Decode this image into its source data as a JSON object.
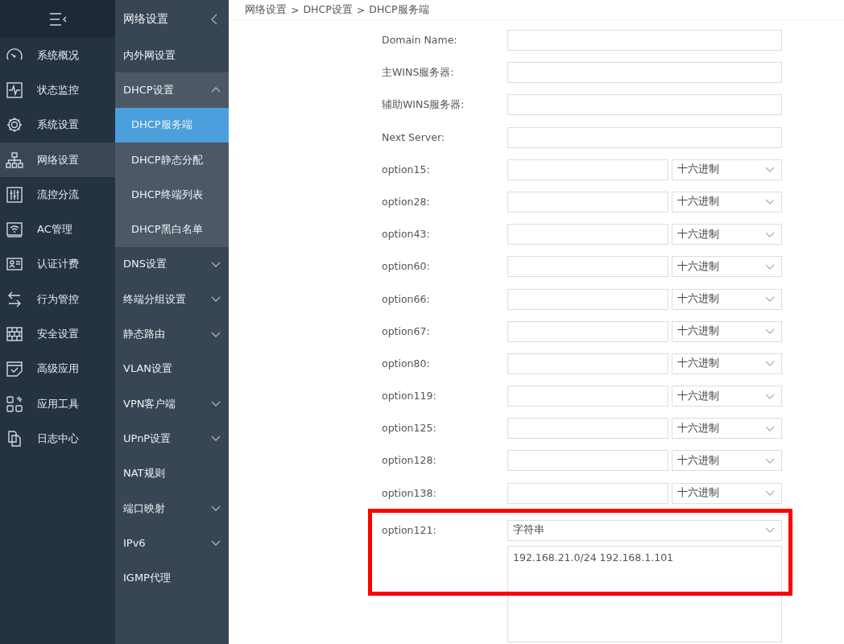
{
  "main_nav": {
    "items": [
      {
        "label": "系统概况",
        "selected": false
      },
      {
        "label": "状态监控",
        "selected": false
      },
      {
        "label": "系统设置",
        "selected": false
      },
      {
        "label": "网络设置",
        "selected": true
      },
      {
        "label": "流控分流",
        "selected": false
      },
      {
        "label": "AC管理",
        "selected": false
      },
      {
        "label": "认证计费",
        "selected": false
      },
      {
        "label": "行为管控",
        "selected": false
      },
      {
        "label": "安全设置",
        "selected": false
      },
      {
        "label": "高级应用",
        "selected": false
      },
      {
        "label": "应用工具",
        "selected": false
      },
      {
        "label": "日志中心",
        "selected": false
      }
    ]
  },
  "sub_nav": {
    "title": "网络设置",
    "items": [
      {
        "label": "内外网设置",
        "selected": false
      },
      {
        "label": "DHCP设置",
        "selected": false,
        "expanded": true,
        "children": [
          {
            "label": "DHCP服务端",
            "selected": true
          },
          {
            "label": "DHCP静态分配",
            "selected": false
          },
          {
            "label": "DHCP终端列表",
            "selected": false
          },
          {
            "label": "DHCP黑白名单",
            "selected": false
          }
        ]
      },
      {
        "label": "DNS设置",
        "selected": false,
        "expanded": false
      },
      {
        "label": "终端分组设置",
        "selected": false,
        "expanded": false
      },
      {
        "label": "静态路由",
        "selected": false,
        "expanded": false
      },
      {
        "label": "VLAN设置",
        "selected": false
      },
      {
        "label": "VPN客户端",
        "selected": false,
        "expanded": false
      },
      {
        "label": "UPnP设置",
        "selected": false,
        "expanded": false
      },
      {
        "label": "NAT规则",
        "selected": false
      },
      {
        "label": "端口映射",
        "selected": false,
        "expanded": false
      },
      {
        "label": "IPv6",
        "selected": false,
        "expanded": false
      },
      {
        "label": "IGMP代理",
        "selected": false
      }
    ]
  },
  "breadcrumb": [
    "网络设置",
    "DHCP设置",
    "DHCP服务端"
  ],
  "breadcrumb_separator": ">",
  "form": {
    "rows": [
      {
        "kind": "text",
        "label": "Domain Name:"
      },
      {
        "kind": "text",
        "label": "主WINS服务器:"
      },
      {
        "kind": "text",
        "label": "辅助WINS服务器:"
      },
      {
        "kind": "text",
        "label": "Next Server:"
      },
      {
        "kind": "option",
        "label": "option15:",
        "format": "十六进制"
      },
      {
        "kind": "option",
        "label": "option28:",
        "format": "十六进制"
      },
      {
        "kind": "option",
        "label": "option43:",
        "format": "十六进制"
      },
      {
        "kind": "option",
        "label": "option60:",
        "format": "十六进制"
      },
      {
        "kind": "option",
        "label": "option66:",
        "format": "十六进制"
      },
      {
        "kind": "option",
        "label": "option67:",
        "format": "十六进制"
      },
      {
        "kind": "option",
        "label": "option80:",
        "format": "十六进制"
      },
      {
        "kind": "option",
        "label": "option119:",
        "format": "十六进制"
      },
      {
        "kind": "option",
        "label": "option125:",
        "format": "十六进制"
      },
      {
        "kind": "option",
        "label": "option128:",
        "format": "十六进制"
      },
      {
        "kind": "option",
        "label": "option138:",
        "format": "十六进制"
      },
      {
        "kind": "string",
        "label": "option121:",
        "format": "字符串",
        "value": "192.168.21.0/24 192.168.1.101",
        "highlighted": true
      }
    ]
  }
}
